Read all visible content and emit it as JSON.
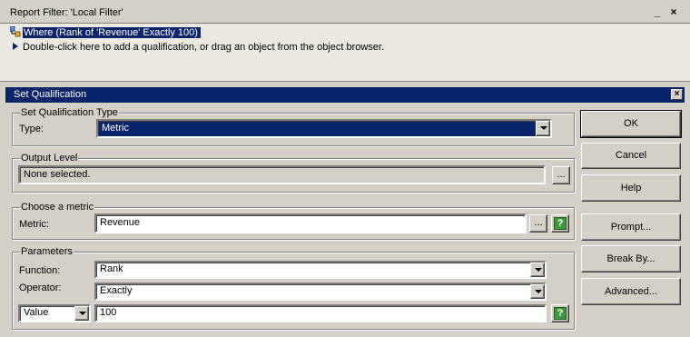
{
  "filter_pane": {
    "title": "Report Filter: 'Local Filter'",
    "controls": {
      "minimize": "_",
      "close": "×"
    },
    "selected_item": "Where (Rank of 'Revenue' Exactly 100)",
    "hint": "Double-click here to add a qualification, or drag an object from the object browser."
  },
  "dialog": {
    "title": "Set Qualification",
    "close_glyph": "×",
    "qual_type": {
      "group_label": "Set Qualification Type",
      "type_label": "Type:",
      "type_value": "Metric"
    },
    "output_level": {
      "group_label": "Output Level",
      "value": "None selected.",
      "browse_label": "..."
    },
    "metric": {
      "group_label": "Choose a metric",
      "metric_label": "Metric:",
      "metric_value": "Revenue",
      "browse_label": "..."
    },
    "parameters": {
      "group_label": "Parameters",
      "function_label": "Function:",
      "function_value": "Rank",
      "operator_label": "Operator:",
      "operator_value": "Exactly",
      "value_type": "Value",
      "value": "100"
    },
    "buttons": {
      "ok": "OK",
      "cancel": "Cancel",
      "help": "Help",
      "prompt": "Prompt...",
      "break_by": "Break By...",
      "advanced": "Advanced..."
    }
  },
  "colors": {
    "titlebar": "#0a246a",
    "face": "#d4d0c8",
    "help_icon": "#3c9a3c"
  },
  "icons": [
    "filter-tree-icon",
    "arrow-bullet-icon",
    "help-question-icon",
    "dropdown-arrow-icon",
    "close-icon",
    "minimize-icon"
  ]
}
